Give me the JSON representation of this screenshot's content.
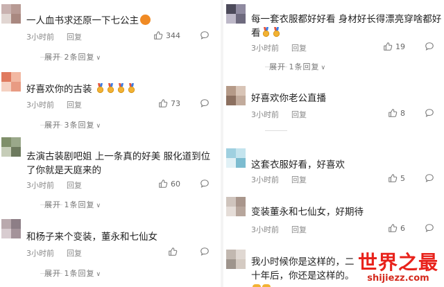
{
  "comments_left": [
    {
      "text": "一人血书求还原一下七公主",
      "time": "3小时前",
      "reply": "回复",
      "likes": "344",
      "expand": "展开 2条回复"
    },
    {
      "text": "好喜欢你的古装",
      "time": "3小时前",
      "reply": "回复",
      "likes": "73",
      "expand": "展开 3条回复"
    },
    {
      "text": "去演古装剧吧姐 上一条真的好美 服化道到位了你就是天庭来的",
      "time": "3小时前",
      "reply": "回复",
      "likes": "60",
      "expand": "展开 1条回复"
    },
    {
      "text": "和杨子来个变装，董永和七仙女",
      "time": "3小时前",
      "reply": "回复",
      "likes": "",
      "expand": "展开 1条回复"
    }
  ],
  "comments_right": [
    {
      "text": "每一套衣服都好好看 身材好长得漂亮穿啥都好看",
      "time": "3小时前",
      "reply": "回复",
      "likes": "19",
      "expand": "展开 1条回复"
    },
    {
      "text": "好喜欢你老公直播",
      "time": "3小时前",
      "reply": "回复",
      "likes": "8",
      "expand": ""
    },
    {
      "text": "这套衣服好看，好喜欢",
      "time": "3小时前",
      "reply": "回复",
      "likes": "5",
      "expand": ""
    },
    {
      "text": "变装董永和七仙女，好期待",
      "time": "3小时前",
      "reply": "回复",
      "likes": "6",
      "expand": ""
    },
    {
      "text": "我小时候你是这样的，二十年后，你还是这样的。",
      "time": "",
      "reply": "",
      "likes": "",
      "expand": ""
    }
  ],
  "watermark": {
    "title": "世界之最",
    "url": "shijiezz.com"
  },
  "colors": {
    "meta_gray": "#888888",
    "medal_gold": "#f2b233",
    "watermark_red": "#e8221b"
  },
  "icons": {
    "like": "thumbs-up-icon",
    "comment": "comment-icon",
    "chevron": "chevron-down-icon",
    "medal": "medal-emoji",
    "cat": "cat-face-emoji",
    "shy": "hands-emoji"
  }
}
